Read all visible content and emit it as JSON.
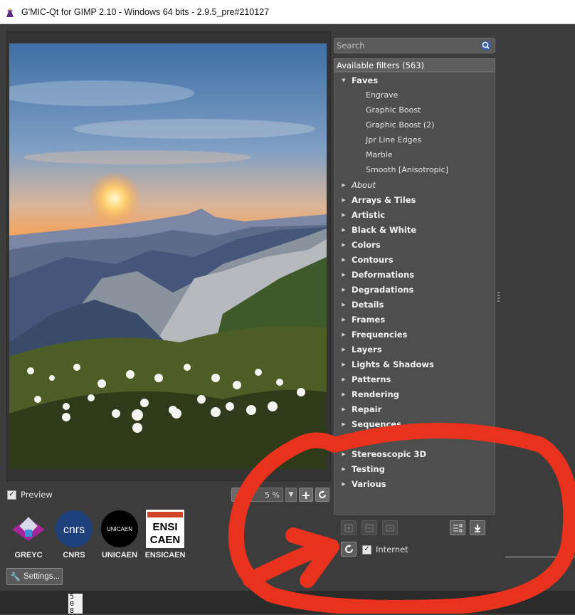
{
  "window": {
    "title": "G'MIC-Qt for GIMP 2.10 - Windows 64 bits - 2.9.5_pre#210127",
    "app_icon": "gmic-wizard-icon"
  },
  "preview": {
    "checkbox_label": "Preview",
    "checked": true
  },
  "zoom": {
    "value": "5 %",
    "plus_icon": "zoom-in-icon",
    "minus_icon": "zoom-out-icon",
    "reset_icon": "reset-zoom-icon"
  },
  "logos": [
    {
      "label": "GREYC"
    },
    {
      "label": "CNRS",
      "mark_text": "cnrs"
    },
    {
      "label": "UNICAEN",
      "mark_text": "UNICAEN"
    },
    {
      "label": "ENSICAEN",
      "mark_text_1": "ENSI",
      "mark_text_2": "CAEN"
    }
  ],
  "settings_button": {
    "label": "Settings..."
  },
  "ruler": {
    "chars": [
      "5",
      "0",
      "8"
    ]
  },
  "search": {
    "placeholder": "Search"
  },
  "filters": {
    "header": "Available filters (563)",
    "faves": {
      "label": "Faves",
      "items": [
        "Engrave",
        "Graphic Boost",
        "Graphic Boost (2)",
        "Jpr Line Edges",
        "Marble",
        "Smooth [Anisotropic]"
      ]
    },
    "categories": [
      {
        "label": "About",
        "italic": true
      },
      {
        "label": "Arrays & Tiles"
      },
      {
        "label": "Artistic"
      },
      {
        "label": "Black & White"
      },
      {
        "label": "Colors"
      },
      {
        "label": "Contours"
      },
      {
        "label": "Deformations"
      },
      {
        "label": "Degradations"
      },
      {
        "label": "Details"
      },
      {
        "label": "Frames"
      },
      {
        "label": "Frequencies"
      },
      {
        "label": "Layers"
      },
      {
        "label": "Lights & Shadows"
      },
      {
        "label": "Patterns"
      },
      {
        "label": "Rendering"
      },
      {
        "label": "Repair"
      },
      {
        "label": "Sequences"
      },
      {
        "label": "Stereoscopic 3D"
      },
      {
        "label": "Testing"
      },
      {
        "label": "Various"
      }
    ]
  },
  "internet": {
    "label": "Internet",
    "checked": true
  },
  "colors": {
    "annotation_red": "#e8321e",
    "panel_bg": "#3c3c3c",
    "list_bg": "#4e4e4e"
  }
}
